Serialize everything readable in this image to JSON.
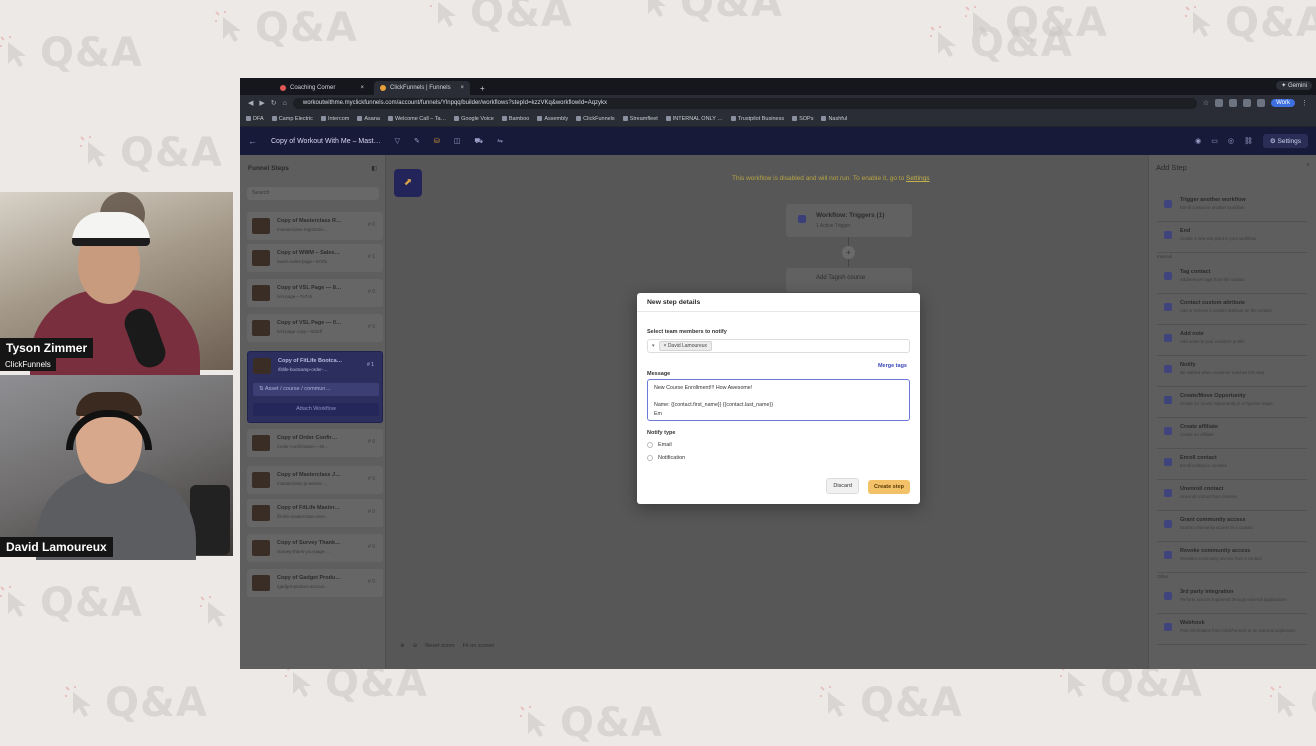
{
  "background": {
    "watermark_text": "Q&A"
  },
  "participants": [
    {
      "name": "Tyson Zimmer",
      "org": "ClickFunnels"
    },
    {
      "name": "David Lamoureux"
    }
  ],
  "browser": {
    "tabs": [
      {
        "label": "Coaching Corner",
        "close": "×"
      },
      {
        "label": "ClickFunnels | Funnels",
        "close": "×"
      }
    ],
    "new_tab": "+",
    "gemini": "✦ Gemini",
    "url": "workoutwithme.myclickfunnels.com/account/funnels/Ylnpqq/builder/workflows?stepId=kzzVKq&workflowId=Aqzykx",
    "profile": "Work",
    "bookmarks": [
      "DFA",
      "Camp Electric",
      "Intercom",
      "Asana",
      "Welcome Call – Ta…",
      "Google Voice",
      "Bamboo",
      "Assembly",
      "ClickFunnels",
      "Streamfleet",
      "INTERNAL ONLY …",
      "Trustpilot Business",
      "SOPs",
      "Nashful"
    ]
  },
  "appbar": {
    "back": "←",
    "title": "Copy of Workout With Me – Mast…",
    "settings": "⚙ Settings"
  },
  "funnel_steps": {
    "title": "Funnel Steps",
    "search_placeholder": "Search",
    "items": [
      {
        "name": "Copy of Masterclass R…",
        "path": "/masterclass-registratio…",
        "count": "# 0"
      },
      {
        "name": "Copy of WWM – Sales…",
        "path": "/wwm-sales-page-–97dfu",
        "count": "# 1"
      },
      {
        "name": "Copy of VSL Page — 8…",
        "path": "/vsl-page—7e7c6",
        "count": "# 0"
      },
      {
        "name": "Copy of VSL Page — 0…",
        "path": "/vsl-page-copy—832df",
        "count": "# 0"
      },
      {
        "name": "Copy of FitLife Bootca…",
        "path": "/fitlife-bootcamp-order-…",
        "count": "# 1"
      },
      {
        "name": "Copy of Order Confir…",
        "path": "/order-confirmation—40…",
        "count": "# 0"
      },
      {
        "name": "Copy of Masterclass J…",
        "path": "/masterclass-jv-assets-…",
        "count": "# 0"
      },
      {
        "name": "Copy of FitLife Master…",
        "path": "/fit-life-masterclass-reve…",
        "count": "# 0"
      },
      {
        "name": "Copy of Survey Thank…",
        "path": "/survey-thank-you-page-…",
        "count": "# 0"
      },
      {
        "name": "Copy of Gadget Produ…",
        "path": "/gadget-product-accoun…",
        "count": "# 0"
      }
    ],
    "selected_sub": "⇅ Asset / course / commun…",
    "attach_workflow": "Attach Workflow"
  },
  "canvas": {
    "warning": "This workflow is disabled and will not run. To enable it, go to",
    "warning_link": "Settings",
    "trigger_title": "Workflow: Triggers (1)",
    "trigger_sub": "1 Active Trigger",
    "add_symbol": "+",
    "action_label": "Add Tagish course",
    "zoom": [
      "Reset zoom",
      "Fit on screen"
    ]
  },
  "add_step": {
    "title": "Add Step",
    "close": "×",
    "items": [
      {
        "title": "Trigger another workflow",
        "desc": "Enroll contact in another workflow"
      },
      {
        "title": "End",
        "desc": "Create a new exit point in your workflow"
      },
      {
        "section": "Internal"
      },
      {
        "title": "Tag contact",
        "desc": "Add/remove tags from the contact"
      },
      {
        "title": "Contact custom attribute",
        "desc": "Add or remove a custom attribute on the contact"
      },
      {
        "title": "Add note",
        "desc": "Add notes to your contact's profile"
      },
      {
        "title": "Notify",
        "desc": "Be notified when customer reaches this step"
      },
      {
        "title": "Create/Move Opportunity",
        "desc": "Create (or move) Opportunity in a Pipeline Stage"
      },
      {
        "title": "Create affiliate",
        "desc": "Create an affiliate"
      },
      {
        "title": "Enroll contact",
        "desc": "Enroll contact in courses"
      },
      {
        "title": "Unenroll contact",
        "desc": "Unenroll contact from courses"
      },
      {
        "title": "Grant community access",
        "desc": "Grants community access to a contact"
      },
      {
        "title": "Revoke community access",
        "desc": "Revokes community access from a contact"
      },
      {
        "section": "Other"
      },
      {
        "title": "3rd party integration",
        "desc": "Perform actions supported through external applications"
      },
      {
        "title": "Webhook",
        "desc": "Post information from ClickFunnels to an external application"
      }
    ]
  },
  "modal": {
    "title": "New step details",
    "team_label": "Select team members to notify",
    "chip": "× David Lamoureux",
    "merge_tags": "Merge tags",
    "message_label": "Message",
    "message_lines": [
      "New Course Enrollment!!! How Awesome!",
      "",
      "Name: {{contact.first_name}} {{contact.last_name}}",
      "Em"
    ],
    "notify_type_label": "Notify type",
    "notify_options": [
      "Email",
      "Notification"
    ],
    "discard": "Discard",
    "create": "Create step"
  }
}
